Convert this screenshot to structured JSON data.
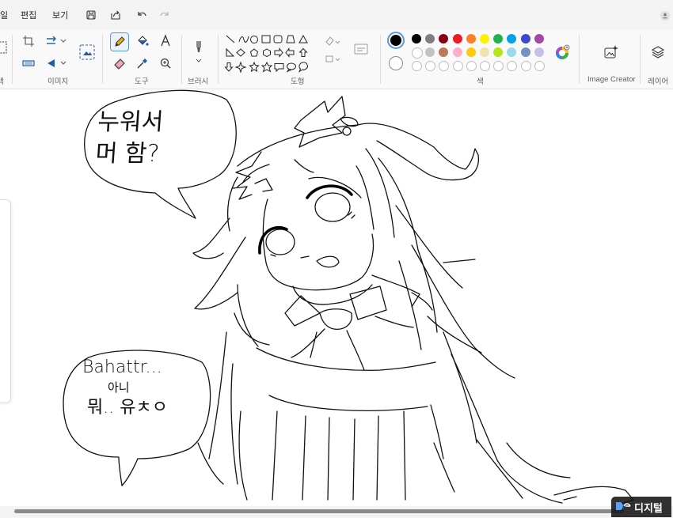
{
  "menu": {
    "file_label": "일",
    "edit_label": "편집",
    "view_label": "보기"
  },
  "ribbon": {
    "image_group": "이미지",
    "tools_group": "도구",
    "brush_group": "브러시",
    "shapes_group": "도형",
    "colors_group": "색",
    "image_creator_label": "Image Creator",
    "layers_label": "레이어",
    "left_cut_label": "택"
  },
  "colors": {
    "primary": "#000000",
    "secondary": "#ffffff",
    "palette_row1": [
      "#000000",
      "#7f7f7f",
      "#880015",
      "#ed1c24",
      "#ff7f27",
      "#fff200",
      "#22b14c",
      "#00a2e8",
      "#3f48cc",
      "#a349a4"
    ],
    "palette_row2": [
      "#ffffff",
      "#c3c3c3",
      "#b97a57",
      "#ffaec9",
      "#ffc90e",
      "#efe4b0",
      "#b5e61d",
      "#99d9ea",
      "#7092be",
      "#c8bfe7"
    ],
    "accent": "#005fb8"
  },
  "canvas": {
    "bubble_top_text": [
      "누워서",
      "머 함?"
    ],
    "bubble_bottom_text": [
      "Bahattr...",
      "아니",
      "뭐.. 유ㅊㅇ"
    ]
  },
  "watermark": {
    "text": "디지털"
  },
  "icons": [
    "save-icon",
    "share-icon",
    "undo-icon",
    "redo-icon",
    "crop-icon",
    "rotate-icon",
    "resize-icon",
    "flip-icon",
    "image-select-icon",
    "pencil-icon",
    "fill-icon",
    "text-icon",
    "eraser-icon",
    "color-picker-icon",
    "magnifier-icon",
    "brush-icon",
    "color-wheel-icon",
    "image-creator-icon",
    "layers-icon"
  ]
}
